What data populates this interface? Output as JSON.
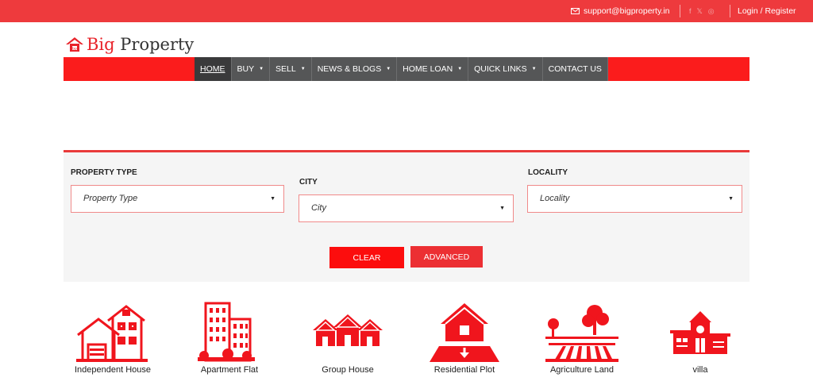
{
  "topbar": {
    "email": "support@bigproperty.in",
    "social": [
      "f",
      "𝕏",
      "◎"
    ],
    "login": "Login / Register"
  },
  "logo": {
    "brand_first": "Big",
    "brand_second": " Property"
  },
  "nav": {
    "items": [
      {
        "label": "HOME",
        "active": true,
        "dropdown": false
      },
      {
        "label": "BUY",
        "dropdown": true
      },
      {
        "label": "SELL",
        "dropdown": true
      },
      {
        "label": "NEWS & BLOGS",
        "dropdown": true
      },
      {
        "label": "HOME LOAN",
        "dropdown": true
      },
      {
        "label": "QUICK LINKS",
        "dropdown": true
      },
      {
        "label": "CONTACT US",
        "dropdown": false
      }
    ]
  },
  "search": {
    "property_type_label": "PROPERTY TYPE",
    "property_type_value": "Property Type",
    "city_label": "CITY",
    "city_value": "City",
    "locality_label": "LOCALITY",
    "locality_value": "Locality",
    "clear_label": "CLEAR",
    "advanced_label": "ADVANCED"
  },
  "categories": [
    {
      "name": "Independent House",
      "icon": "independent-house-icon"
    },
    {
      "name": "Apartment Flat",
      "icon": "apartment-icon"
    },
    {
      "name": "Group House",
      "icon": "group-house-icon"
    },
    {
      "name": "Residential Plot",
      "icon": "residential-plot-icon"
    },
    {
      "name": "Agriculture Land",
      "icon": "agriculture-land-icon"
    },
    {
      "name": "villa",
      "icon": "villa-icon"
    }
  ],
  "colors": {
    "brand_red": "#ee3a3d",
    "nav_red": "#fb1c1c",
    "nav_dark": "#555657",
    "icon_red": "#f0151d"
  }
}
